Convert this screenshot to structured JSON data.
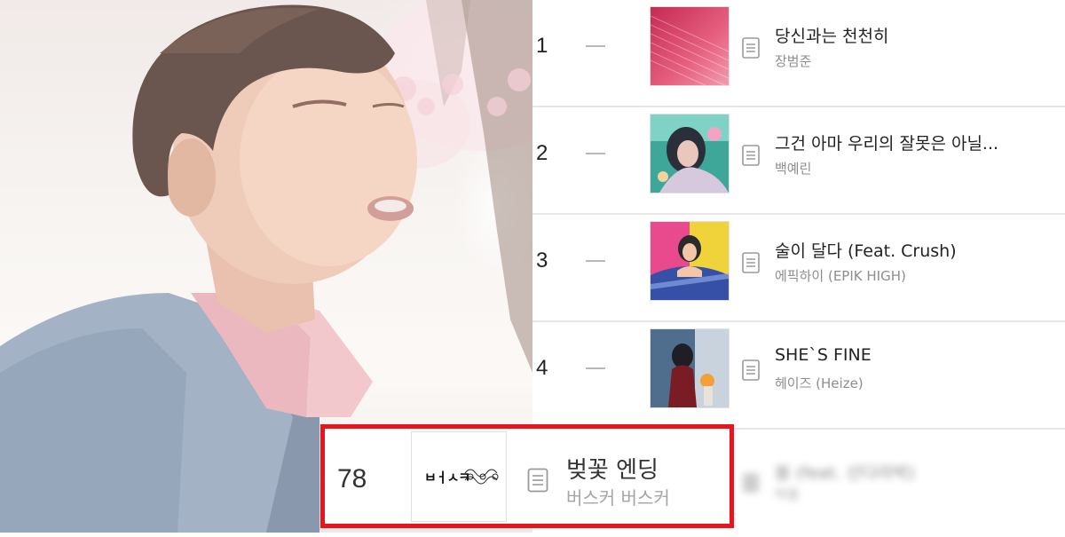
{
  "chart": {
    "rows": [
      {
        "rank": "1",
        "title": "당신과는 천천히",
        "artist": "장범준"
      },
      {
        "rank": "2",
        "title": "그건 아마 우리의 잘못은 아닐...",
        "artist": "백예린"
      },
      {
        "rank": "3",
        "title": "술이 달다 (Feat. Crush)",
        "artist": "에픽하이 (EPIK HIGH)"
      },
      {
        "rank": "4",
        "title": "SHE`S FINE",
        "artist": "헤이즈 (Heize)"
      },
      {
        "rank": "",
        "title": "봄 (feat. 산다라박)",
        "artist": "박봄"
      }
    ]
  },
  "highlight": {
    "rank": "78",
    "title": "벚꽃 엔딩",
    "artist": "버스커 버스커",
    "cover_text": "버스커 버스커",
    "accent_color": "#e8141e"
  },
  "icons": {
    "change": "no-change-dash-icon",
    "lyrics": "lyrics-document-icon"
  }
}
